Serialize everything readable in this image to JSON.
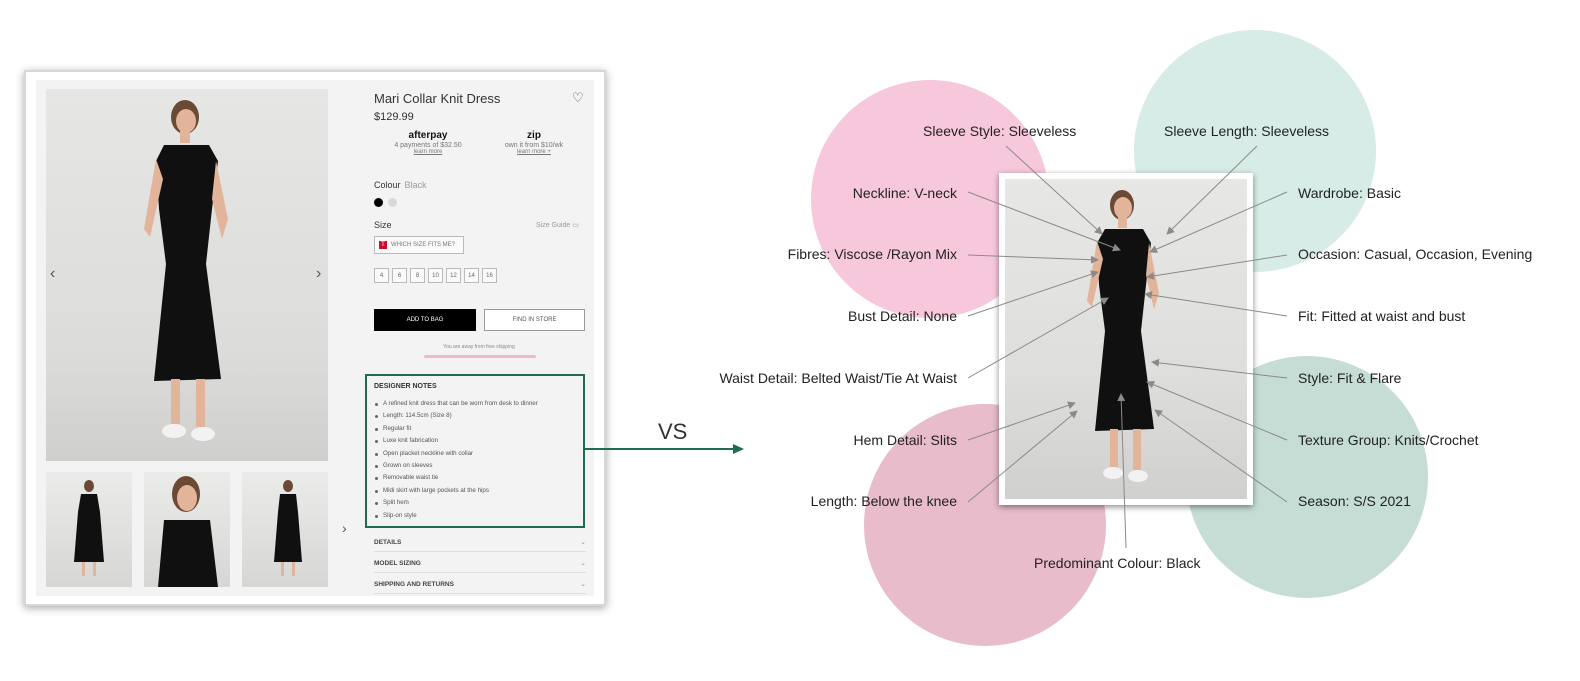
{
  "product": {
    "title": "Mari Collar Knit Dress",
    "price": "$129.99",
    "afterpay": {
      "logo": "afterpay",
      "text": "4 payments of $32.50",
      "link": "learn more"
    },
    "zip": {
      "logo": "zip",
      "text": "own it from $10/wk",
      "link": "learn more +"
    },
    "colour_label": "Colour",
    "colour_value": "Black",
    "colours": [
      "#000000",
      "#d9d9d9"
    ],
    "size_label": "Size",
    "size_guide": "Size Guide",
    "fit_button": "WHICH SIZE FITS ME?",
    "fit_badge": "T",
    "sizes": [
      "4",
      "6",
      "8",
      "10",
      "12",
      "14",
      "16"
    ],
    "add_to_bag": "ADD TO BAG",
    "find_in_store": "FIND IN STORE",
    "shipping_text": "You are away from free shipping",
    "designer_notes_title": "DESIGNER NOTES",
    "designer_notes": [
      "A refined knit dress that can be worn from desk to dinner",
      "Length: 114.5cm (Size 8)",
      "Regular fit",
      "Luxe knit fabrication",
      "Open placket neckline with collar",
      "Grown on sleeves",
      "Removable waist tie",
      "Midi skirt with large pockets at the hips",
      "Split hem",
      "Slip-on style"
    ],
    "accordions": [
      "DETAILS",
      "MODEL SIZING",
      "SHIPPING AND RETURNS"
    ]
  },
  "vs_label": "VS",
  "attributes": {
    "left": [
      "Sleeve Style: Sleeveless",
      "Neckline: V-neck",
      "Fibres: Viscose /Rayon Mix",
      "Bust Detail: None",
      "Waist Detail: Belted Waist/Tie At Waist",
      "Hem Detail: Slits",
      "Length: Below the knee"
    ],
    "right": [
      "Sleeve Length: Sleeveless",
      "Wardrobe: Basic",
      "Occasion: Casual, Occasion, Evening",
      "Fit: Fitted at waist and bust",
      "Style: Fit & Flare",
      "Texture Group: Knits/Crochet",
      "Season: S/S 2021"
    ],
    "bottom": "Predominant Colour: Black"
  },
  "colors": {
    "accent_green": "#1f6b57",
    "blob_pink": "#f7c8dc",
    "blob_mauve": "#e8bccb",
    "blob_mint": "#d7ece6",
    "blob_teal": "#c5ddd5"
  }
}
